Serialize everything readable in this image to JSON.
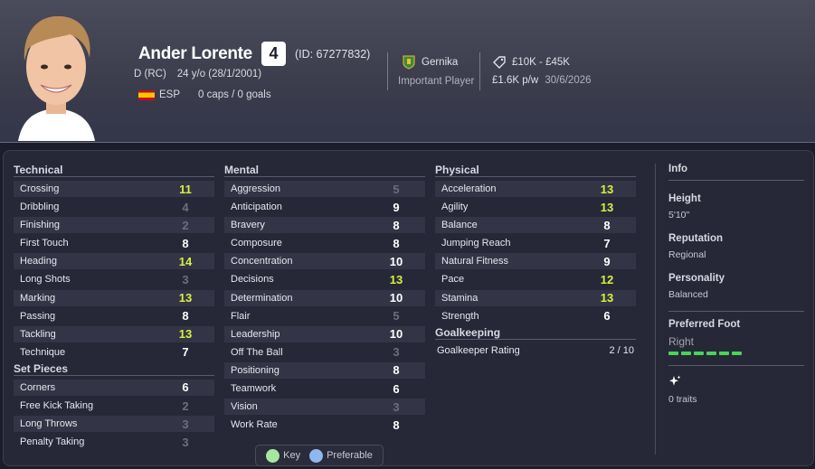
{
  "header": {
    "name": "Ander Lorente",
    "number": "4",
    "id": "(ID: 67277832)",
    "position": "D (RC)",
    "age": "24 y/o (28/1/2001)",
    "nation": "ESP",
    "caps": "0 caps / 0 goals",
    "club": "Gernika",
    "squad_status": "Important Player",
    "value": "£10K - £45K",
    "wage": "£1.6K p/w",
    "contract_expiry": "30/6/2026"
  },
  "technical": {
    "title": "Technical",
    "rows": [
      {
        "label": "Crossing",
        "value": "11",
        "tier": "high"
      },
      {
        "label": "Dribbling",
        "value": "4",
        "tier": "low"
      },
      {
        "label": "Finishing",
        "value": "2",
        "tier": "low"
      },
      {
        "label": "First Touch",
        "value": "8",
        "tier": "mid"
      },
      {
        "label": "Heading",
        "value": "14",
        "tier": "high"
      },
      {
        "label": "Long Shots",
        "value": "3",
        "tier": "low"
      },
      {
        "label": "Marking",
        "value": "13",
        "tier": "high"
      },
      {
        "label": "Passing",
        "value": "8",
        "tier": "mid"
      },
      {
        "label": "Tackling",
        "value": "13",
        "tier": "high"
      },
      {
        "label": "Technique",
        "value": "7",
        "tier": "mid"
      }
    ]
  },
  "set_pieces": {
    "title": "Set Pieces",
    "rows": [
      {
        "label": "Corners",
        "value": "6",
        "tier": "mid"
      },
      {
        "label": "Free Kick Taking",
        "value": "2",
        "tier": "low"
      },
      {
        "label": "Long Throws",
        "value": "3",
        "tier": "low"
      },
      {
        "label": "Penalty Taking",
        "value": "3",
        "tier": "low"
      }
    ]
  },
  "mental": {
    "title": "Mental",
    "rows": [
      {
        "label": "Aggression",
        "value": "5",
        "tier": "low"
      },
      {
        "label": "Anticipation",
        "value": "9",
        "tier": "mid"
      },
      {
        "label": "Bravery",
        "value": "8",
        "tier": "mid"
      },
      {
        "label": "Composure",
        "value": "8",
        "tier": "mid"
      },
      {
        "label": "Concentration",
        "value": "10",
        "tier": "mid"
      },
      {
        "label": "Decisions",
        "value": "13",
        "tier": "high"
      },
      {
        "label": "Determination",
        "value": "10",
        "tier": "mid"
      },
      {
        "label": "Flair",
        "value": "5",
        "tier": "low"
      },
      {
        "label": "Leadership",
        "value": "10",
        "tier": "mid"
      },
      {
        "label": "Off The Ball",
        "value": "3",
        "tier": "low"
      },
      {
        "label": "Positioning",
        "value": "8",
        "tier": "mid"
      },
      {
        "label": "Teamwork",
        "value": "6",
        "tier": "mid"
      },
      {
        "label": "Vision",
        "value": "3",
        "tier": "low"
      },
      {
        "label": "Work Rate",
        "value": "8",
        "tier": "mid"
      }
    ]
  },
  "physical": {
    "title": "Physical",
    "rows": [
      {
        "label": "Acceleration",
        "value": "13",
        "tier": "high"
      },
      {
        "label": "Agility",
        "value": "13",
        "tier": "high"
      },
      {
        "label": "Balance",
        "value": "8",
        "tier": "mid"
      },
      {
        "label": "Jumping Reach",
        "value": "7",
        "tier": "mid"
      },
      {
        "label": "Natural Fitness",
        "value": "9",
        "tier": "mid"
      },
      {
        "label": "Pace",
        "value": "12",
        "tier": "high"
      },
      {
        "label": "Stamina",
        "value": "13",
        "tier": "high"
      },
      {
        "label": "Strength",
        "value": "6",
        "tier": "mid"
      }
    ]
  },
  "goalkeeping": {
    "title": "Goalkeeping",
    "label": "Goalkeeper Rating",
    "value": "2 / 10"
  },
  "info": {
    "title": "Info",
    "height_label": "Height",
    "height": "5'10\"",
    "reputation_label": "Reputation",
    "reputation": "Regional",
    "personality_label": "Personality",
    "personality": "Balanced",
    "foot_label": "Preferred Foot",
    "foot": "Right",
    "traits": "0 traits"
  },
  "key": {
    "key_label": "Key",
    "preferable_label": "Preferable",
    "key_color": "#a8e6a0",
    "preferable_color": "#8fb8f0"
  },
  "colors": {
    "high": "#d9ef3c",
    "mid": "#ffffff",
    "low": "#6c6e7e"
  }
}
